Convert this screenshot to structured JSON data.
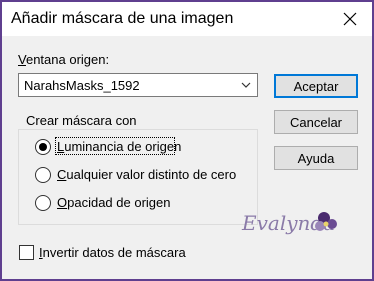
{
  "window": {
    "title": "Añadir máscara de una imagen"
  },
  "source": {
    "label": "Ventana origen:",
    "selected": "NarahsMasks_1592"
  },
  "buttons": {
    "accept": "Aceptar",
    "cancel": "Cancelar",
    "help": "Ayuda"
  },
  "create_mask": {
    "group_label": "Crear máscara con",
    "options": [
      {
        "label": "Luminancia de origen",
        "checked": true
      },
      {
        "label": "Cualquier valor distinto de cero",
        "checked": false
      },
      {
        "label": "Opacidad de origen",
        "checked": false
      }
    ]
  },
  "invert": {
    "label": "Invertir datos de máscara",
    "checked": false
  },
  "watermark": {
    "text": "Evalynda"
  },
  "colors": {
    "outer_border": "#5f3f8f",
    "accent": "#0078d7",
    "dialog_bg": "#f0f0f0",
    "watermark": "#8a7aa8"
  }
}
